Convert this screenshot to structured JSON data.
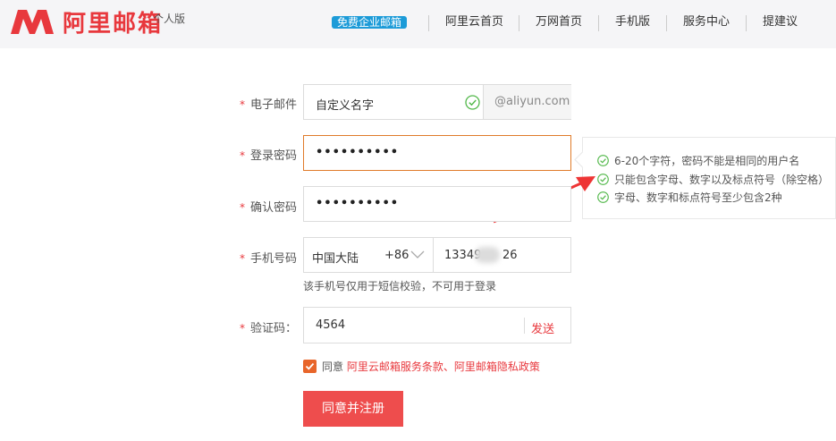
{
  "header": {
    "logo_text": "阿里邮箱",
    "logo_sub": "个人版",
    "colors": {
      "brand": "#e8383d",
      "badge": "#1c9bd8"
    },
    "nav": [
      {
        "label": "免费企业邮箱",
        "badge": true
      },
      {
        "label": "阿里云首页"
      },
      {
        "label": "万网首页"
      },
      {
        "label": "手机版"
      },
      {
        "label": "服务中心"
      },
      {
        "label": "提建议"
      }
    ]
  },
  "form": {
    "email": {
      "label": "电子邮件",
      "value": "自定义名字",
      "suffix": "@aliyun.com"
    },
    "password": {
      "label": "登录密码",
      "value": "••••••••••"
    },
    "confirm": {
      "label": "确认密码",
      "value": "••••••••••"
    },
    "phone": {
      "label": "手机号码",
      "region": "中国大陆",
      "code": "+86",
      "number_start": "13349",
      "number_end": "26",
      "hint": "该手机号仅用于短信校验，不可用于登录"
    },
    "captcha": {
      "label": "验证码：",
      "value": "4564",
      "send_label": "发送"
    },
    "agree": {
      "prefix": "同意",
      "terms": "阿里云邮箱服务条款、阿里邮箱隐私政策"
    },
    "submit_label": "同意并注册"
  },
  "password_tips": [
    "6-20个字符，密码不能是相同的用户名",
    "只能包含字母、数字以及标点符号（除空格）",
    "字母、数字和标点符号至少包含2种"
  ],
  "required_mark": "*",
  "icons": [
    "logo-m-icon",
    "check-circle-icon",
    "chevron-down-icon",
    "checkbox-check-icon",
    "arrow-annotation-icon"
  ]
}
